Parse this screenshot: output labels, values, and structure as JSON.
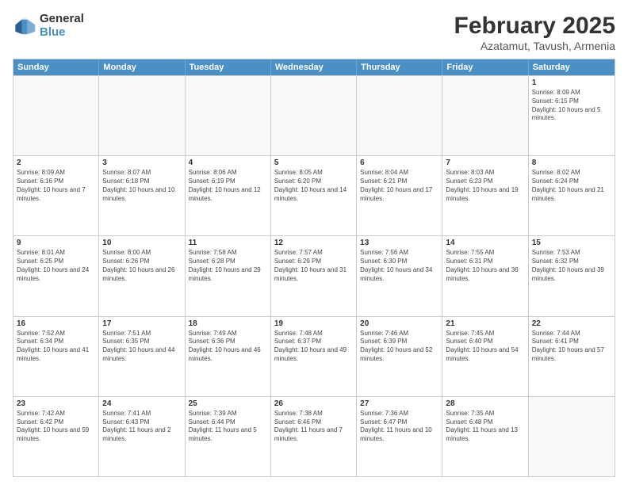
{
  "logo": {
    "general": "General",
    "blue": "Blue"
  },
  "header": {
    "title": "February 2025",
    "subtitle": "Azatamut, Tavush, Armenia"
  },
  "days": [
    "Sunday",
    "Monday",
    "Tuesday",
    "Wednesday",
    "Thursday",
    "Friday",
    "Saturday"
  ],
  "weeks": [
    [
      {
        "day": "",
        "info": ""
      },
      {
        "day": "",
        "info": ""
      },
      {
        "day": "",
        "info": ""
      },
      {
        "day": "",
        "info": ""
      },
      {
        "day": "",
        "info": ""
      },
      {
        "day": "",
        "info": ""
      },
      {
        "day": "1",
        "info": "Sunrise: 8:09 AM\nSunset: 6:15 PM\nDaylight: 10 hours and 5 minutes."
      }
    ],
    [
      {
        "day": "2",
        "info": "Sunrise: 8:09 AM\nSunset: 6:16 PM\nDaylight: 10 hours and 7 minutes."
      },
      {
        "day": "3",
        "info": "Sunrise: 8:07 AM\nSunset: 6:18 PM\nDaylight: 10 hours and 10 minutes."
      },
      {
        "day": "4",
        "info": "Sunrise: 8:06 AM\nSunset: 6:19 PM\nDaylight: 10 hours and 12 minutes."
      },
      {
        "day": "5",
        "info": "Sunrise: 8:05 AM\nSunset: 6:20 PM\nDaylight: 10 hours and 14 minutes."
      },
      {
        "day": "6",
        "info": "Sunrise: 8:04 AM\nSunset: 6:21 PM\nDaylight: 10 hours and 17 minutes."
      },
      {
        "day": "7",
        "info": "Sunrise: 8:03 AM\nSunset: 6:23 PM\nDaylight: 10 hours and 19 minutes."
      },
      {
        "day": "8",
        "info": "Sunrise: 8:02 AM\nSunset: 6:24 PM\nDaylight: 10 hours and 21 minutes."
      }
    ],
    [
      {
        "day": "9",
        "info": "Sunrise: 8:01 AM\nSunset: 6:25 PM\nDaylight: 10 hours and 24 minutes."
      },
      {
        "day": "10",
        "info": "Sunrise: 8:00 AM\nSunset: 6:26 PM\nDaylight: 10 hours and 26 minutes."
      },
      {
        "day": "11",
        "info": "Sunrise: 7:58 AM\nSunset: 6:28 PM\nDaylight: 10 hours and 29 minutes."
      },
      {
        "day": "12",
        "info": "Sunrise: 7:57 AM\nSunset: 6:29 PM\nDaylight: 10 hours and 31 minutes."
      },
      {
        "day": "13",
        "info": "Sunrise: 7:56 AM\nSunset: 6:30 PM\nDaylight: 10 hours and 34 minutes."
      },
      {
        "day": "14",
        "info": "Sunrise: 7:55 AM\nSunset: 6:31 PM\nDaylight: 10 hours and 36 minutes."
      },
      {
        "day": "15",
        "info": "Sunrise: 7:53 AM\nSunset: 6:32 PM\nDaylight: 10 hours and 39 minutes."
      }
    ],
    [
      {
        "day": "16",
        "info": "Sunrise: 7:52 AM\nSunset: 6:34 PM\nDaylight: 10 hours and 41 minutes."
      },
      {
        "day": "17",
        "info": "Sunrise: 7:51 AM\nSunset: 6:35 PM\nDaylight: 10 hours and 44 minutes."
      },
      {
        "day": "18",
        "info": "Sunrise: 7:49 AM\nSunset: 6:36 PM\nDaylight: 10 hours and 46 minutes."
      },
      {
        "day": "19",
        "info": "Sunrise: 7:48 AM\nSunset: 6:37 PM\nDaylight: 10 hours and 49 minutes."
      },
      {
        "day": "20",
        "info": "Sunrise: 7:46 AM\nSunset: 6:39 PM\nDaylight: 10 hours and 52 minutes."
      },
      {
        "day": "21",
        "info": "Sunrise: 7:45 AM\nSunset: 6:40 PM\nDaylight: 10 hours and 54 minutes."
      },
      {
        "day": "22",
        "info": "Sunrise: 7:44 AM\nSunset: 6:41 PM\nDaylight: 10 hours and 57 minutes."
      }
    ],
    [
      {
        "day": "23",
        "info": "Sunrise: 7:42 AM\nSunset: 6:42 PM\nDaylight: 10 hours and 59 minutes."
      },
      {
        "day": "24",
        "info": "Sunrise: 7:41 AM\nSunset: 6:43 PM\nDaylight: 11 hours and 2 minutes."
      },
      {
        "day": "25",
        "info": "Sunrise: 7:39 AM\nSunset: 6:44 PM\nDaylight: 11 hours and 5 minutes."
      },
      {
        "day": "26",
        "info": "Sunrise: 7:38 AM\nSunset: 6:46 PM\nDaylight: 11 hours and 7 minutes."
      },
      {
        "day": "27",
        "info": "Sunrise: 7:36 AM\nSunset: 6:47 PM\nDaylight: 11 hours and 10 minutes."
      },
      {
        "day": "28",
        "info": "Sunrise: 7:35 AM\nSunset: 6:48 PM\nDaylight: 11 hours and 13 minutes."
      },
      {
        "day": "",
        "info": ""
      }
    ]
  ]
}
